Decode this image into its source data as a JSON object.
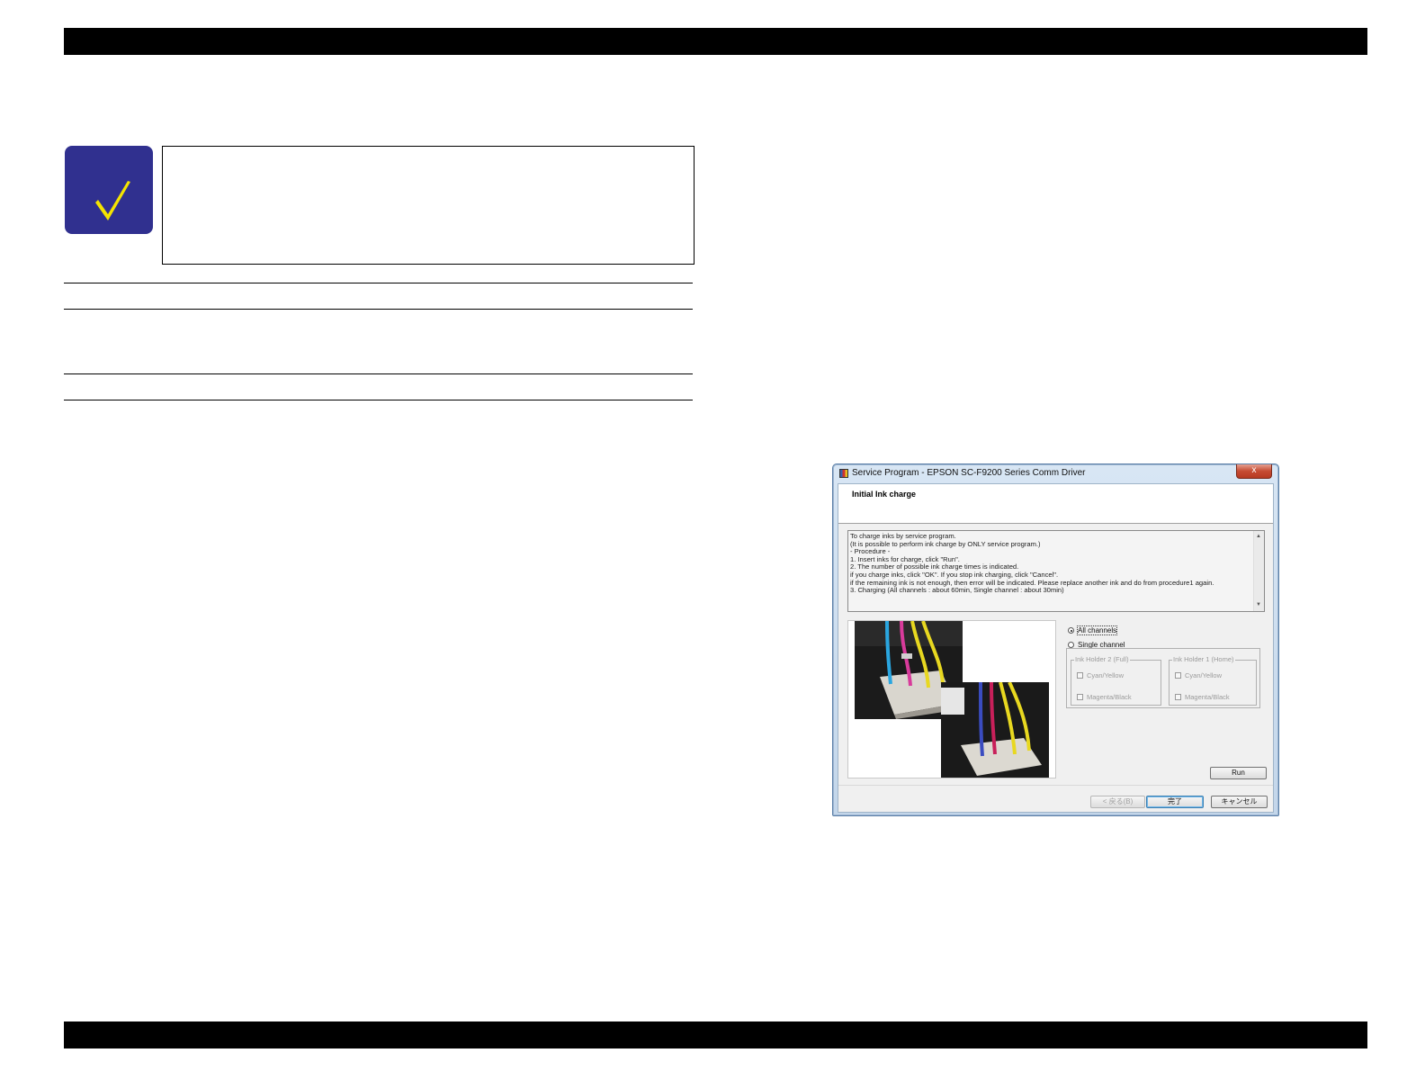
{
  "dialog": {
    "title": "Service Program - EPSON SC-F9200 Series Comm Driver",
    "close_label": "x",
    "header_title": "Initial Ink charge",
    "message_lines": [
      "To charge inks by service program.",
      "(It is possible to perform ink charge by ONLY service program.)",
      "- Procedure -",
      "1. Insert inks for charge, click \"Run\".",
      "2. The number of possible ink charge times is indicated.",
      "  if you charge inks, click \"OK\". If you stop ink charging, click \"Cancel\".",
      "  if the remaining ink is not enough, then error will be indicated. Please replace another ink and do from procedure1 again.",
      "3. Charging (All channels : about 60min, Single channel : about 30min)"
    ],
    "options": {
      "all_channels": "All channels",
      "single_channel": "Single channel",
      "selected": "all_channels"
    },
    "groups": [
      {
        "legend": "Ink Holder 2 (Full)",
        "items": [
          "Cyan/Yellow",
          "Magenta/Black"
        ]
      },
      {
        "legend": "Ink Holder 1 (Home)",
        "items": [
          "Cyan/Yellow",
          "Magenta/Black"
        ]
      }
    ],
    "buttons": {
      "run": "Run",
      "back": "< 戻る(B)",
      "finish": "完了",
      "cancel": "キャンセル"
    }
  },
  "icons": {
    "note": "checkmark-icon",
    "app": "printer-icon"
  },
  "colors": {
    "badge_bg": "#30308f",
    "checkmark": "#f5e400",
    "bars": "#000000"
  }
}
